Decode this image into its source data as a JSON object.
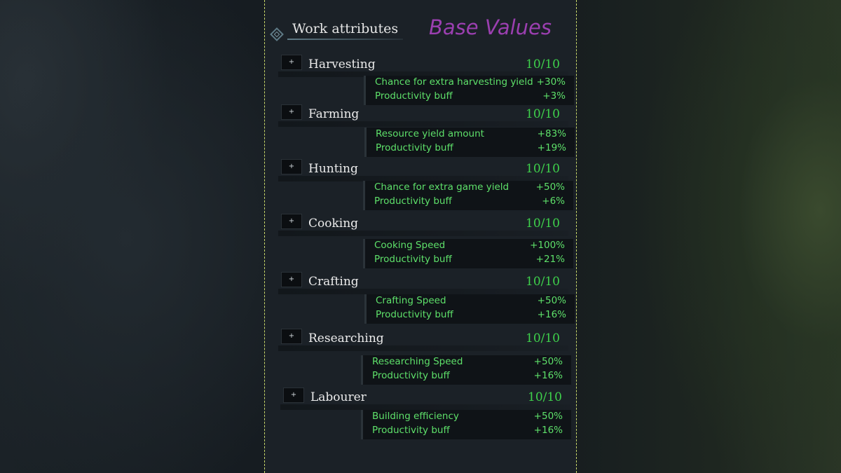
{
  "panel": {
    "title": "Work attributes",
    "overlay_label": "Base Values",
    "overlay_color": "#9b3fb0",
    "accent_green": "#3ed14b",
    "header_icon": "diamond-ornament-icon"
  },
  "attributes": [
    {
      "name": "Harvesting",
      "level": "10/10",
      "button": "+",
      "details": [
        {
          "label": "Chance for extra harvesting yield",
          "value": "+30%"
        },
        {
          "label": "Productivity buff",
          "value": "+3%"
        }
      ]
    },
    {
      "name": "Farming",
      "level": "10/10",
      "button": "+",
      "details": [
        {
          "label": "Resource yield amount",
          "value": "+83%"
        },
        {
          "label": "Productivity buff",
          "value": "+19%"
        }
      ]
    },
    {
      "name": "Hunting",
      "level": "10/10",
      "button": "+",
      "details": [
        {
          "label": "Chance for extra game yield",
          "value": "+50%"
        },
        {
          "label": "Productivity buff",
          "value": "+6%"
        }
      ]
    },
    {
      "name": "Cooking",
      "level": "10/10",
      "button": "+",
      "details": [
        {
          "label": "Cooking Speed",
          "value": "+100%"
        },
        {
          "label": "Productivity buff",
          "value": "+21%"
        }
      ]
    },
    {
      "name": "Crafting",
      "level": "10/10",
      "button": "+",
      "details": [
        {
          "label": "Crafting Speed",
          "value": "+50%"
        },
        {
          "label": "Productivity buff",
          "value": "+16%"
        }
      ]
    },
    {
      "name": "Researching",
      "level": "10/10",
      "button": "+",
      "details": [
        {
          "label": "Researching Speed",
          "value": "+50%"
        },
        {
          "label": "Productivity buff",
          "value": "+16%"
        }
      ]
    },
    {
      "name": "Labourer",
      "level": "10/10",
      "button": "+",
      "details": [
        {
          "label": "Building efficiency",
          "value": "+50%"
        },
        {
          "label": "Productivity buff",
          "value": "+16%"
        }
      ]
    }
  ]
}
